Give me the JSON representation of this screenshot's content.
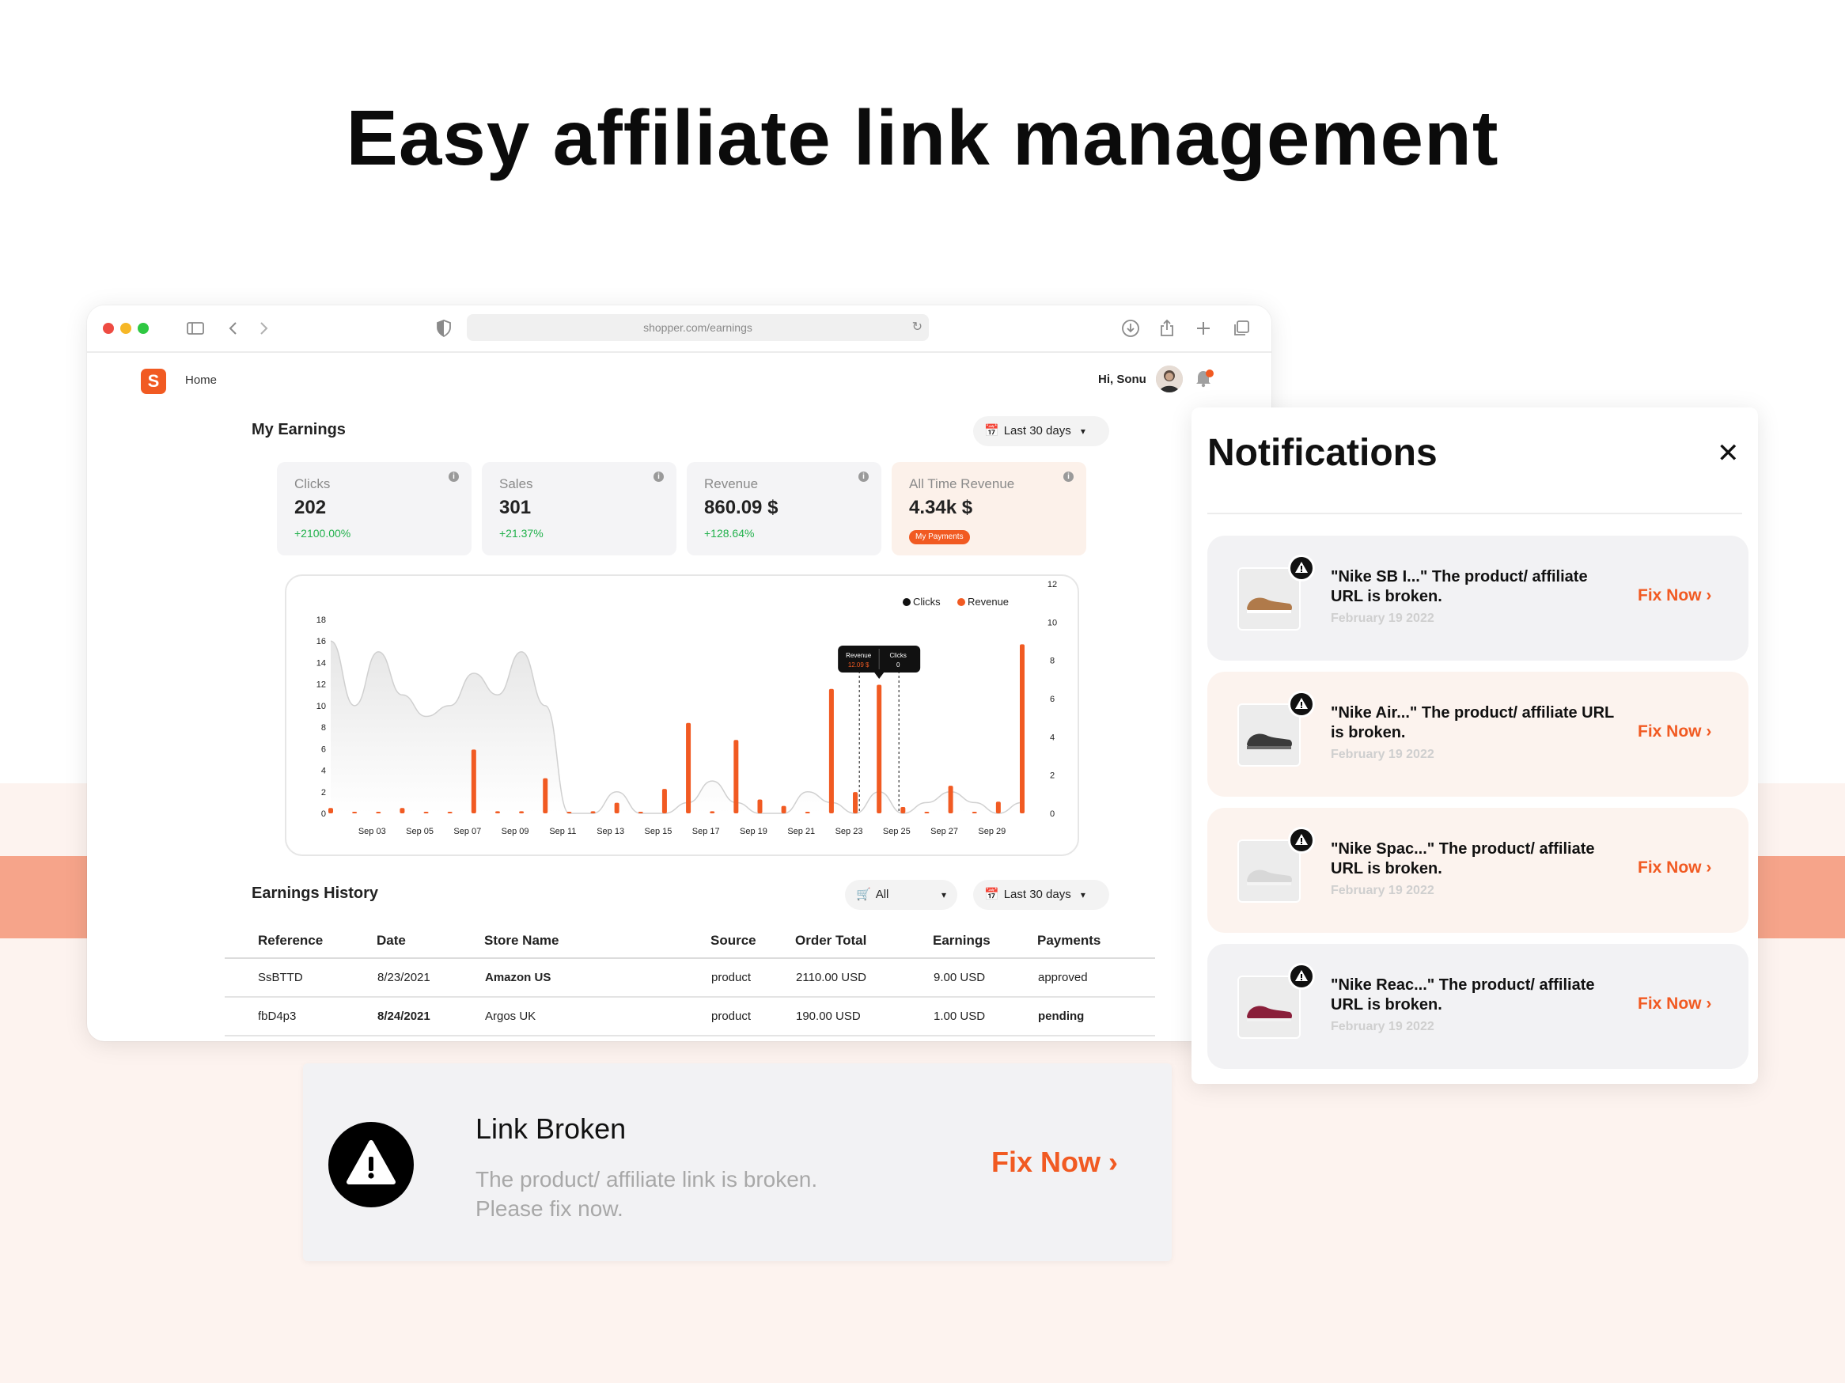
{
  "hero": {
    "title": "Easy affiliate link management"
  },
  "browser": {
    "url": "shopper.com/earnings",
    "traffic_colors": [
      "#ee4b42",
      "#f6b726",
      "#2fc842"
    ]
  },
  "app": {
    "logo_letter": "S",
    "nav_home": "Home",
    "greeting": "Hi, Sonu",
    "accent": "#f15a22"
  },
  "earnings": {
    "title": "My Earnings",
    "date_range": "Last 30 days",
    "stats": [
      {
        "label": "Clicks",
        "value": "202",
        "delta": "+2100.00%"
      },
      {
        "label": "Sales",
        "value": "301",
        "delta": "+21.37%"
      },
      {
        "label": "Revenue",
        "value": "860.09 $",
        "delta": "+128.64%"
      },
      {
        "label": "All Time Revenue",
        "value": "4.34k $",
        "button": "My Payments"
      }
    ]
  },
  "chart_data": {
    "type": "bar",
    "legend": [
      "Clicks",
      "Revenue"
    ],
    "legend_position": "top-right",
    "x_ticks": [
      "Sep 03",
      "Sep 05",
      "Sep 07",
      "Sep 09",
      "Sep 11",
      "Sep 13",
      "Sep 15",
      "Sep 17",
      "Sep 19",
      "Sep 21",
      "Sep 23",
      "Sep 25",
      "Sep 27",
      "Sep 29"
    ],
    "left_axis": {
      "ticks": [
        0,
        2,
        4,
        6,
        8,
        10,
        12,
        14,
        16,
        18
      ],
      "ylim": [
        0,
        18
      ]
    },
    "right_axis": {
      "ticks": [
        0,
        2,
        4,
        6,
        8,
        10,
        12
      ],
      "ylim": [
        0,
        12
      ]
    },
    "series": [
      {
        "name": "Clicks",
        "kind": "area",
        "color": "#d8d8d8",
        "values": [
          16,
          10,
          15,
          11,
          9,
          10,
          13,
          11,
          15,
          10,
          0,
          0,
          2,
          0,
          0,
          1,
          3,
          1,
          0,
          0,
          2,
          1,
          0,
          2,
          0,
          1,
          2,
          1,
          0,
          1
        ]
      },
      {
        "name": "Revenue",
        "kind": "bar",
        "color": "#f15a22",
        "values": [
          0.5,
          0,
          0,
          0.5,
          0,
          0,
          6,
          0.2,
          0.2,
          3.3,
          0,
          0.2,
          1,
          0,
          2.3,
          8.5,
          0.2,
          6.9,
          1.3,
          0.7,
          0,
          11.7,
          2,
          12.09,
          0.6,
          0,
          2.6,
          0,
          1.1,
          15.9
        ]
      }
    ],
    "tooltip": {
      "revenue_label": "Revenue",
      "revenue_value": "12.09 $",
      "clicks_label": "Clicks",
      "clicks_value": "0"
    }
  },
  "history": {
    "title": "Earnings History",
    "filter": "All",
    "date_range": "Last 30 days",
    "columns": [
      "Reference",
      "Date",
      "Store Name",
      "Source",
      "Order Total",
      "Earnings",
      "Payments"
    ],
    "rows": [
      [
        "SsBTTD",
        "8/23/2021",
        "Amazon US",
        "product",
        "2110.00 USD",
        "9.00 USD",
        "approved"
      ],
      [
        "fbD4p3",
        "8/24/2021",
        "Argos UK",
        "product",
        "190.00 USD",
        "1.00 USD",
        "pending"
      ]
    ]
  },
  "notifications": {
    "title": "Notifications",
    "items": [
      {
        "text": "\"Nike SB I...\" The product/ affiliate URL is broken.",
        "date": "February 19 2022",
        "action": "Fix Now",
        "shoe_color": "#b07a4a"
      },
      {
        "text": "\"Nike Air...\" The product/ affiliate URL is broken.",
        "date": "February 19 2022",
        "action": "Fix Now",
        "shoe_color": "#3a3a3a"
      },
      {
        "text": "\"Nike Spac...\" The product/ affiliate URL is broken.",
        "date": "February 19 2022",
        "action": "Fix Now",
        "shoe_color": "#d8d8d8"
      },
      {
        "text": "\"Nike Reac...\" The product/ affiliate URL is broken.",
        "date": "February 19 2022",
        "action": "Fix Now",
        "shoe_color": "#8a1f3a"
      }
    ]
  },
  "toast": {
    "title": "Link Broken",
    "message_line1": "The product/ affiliate link is broken.",
    "message_line2": "Please fix now.",
    "action": "Fix Now"
  }
}
